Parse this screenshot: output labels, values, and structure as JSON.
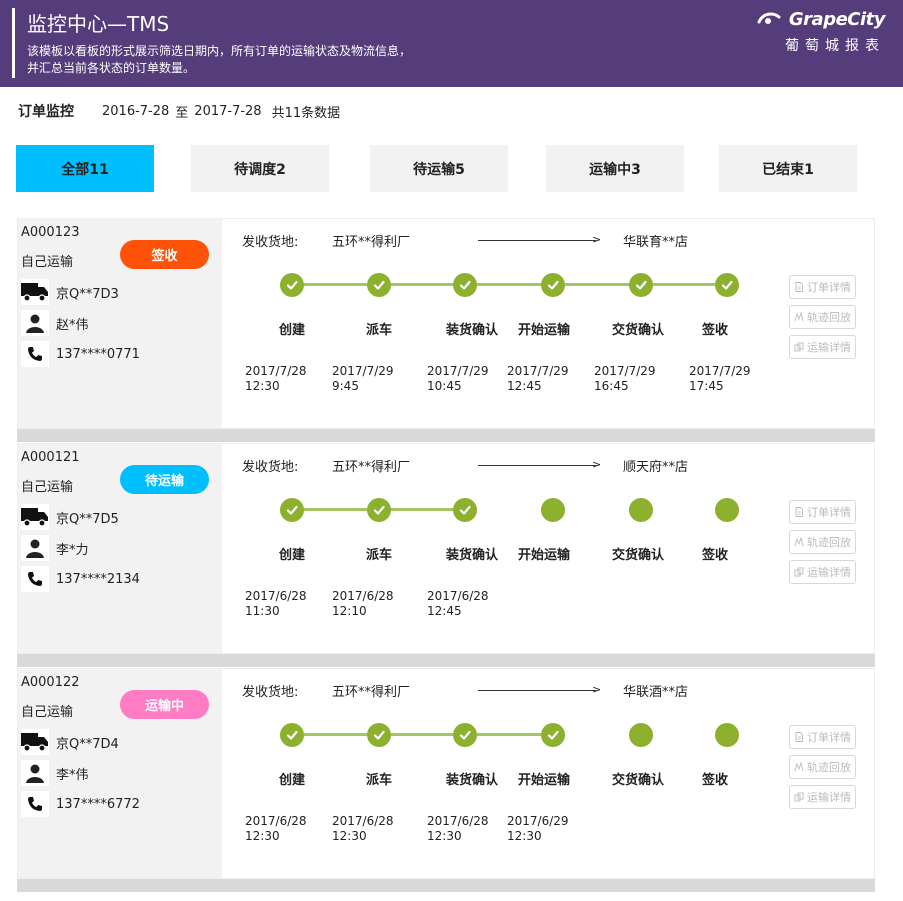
{
  "header": {
    "title": "监控中心—TMS",
    "desc_line1": "该模板以看板的形式展示筛选日期内，所有订单的运输状态及物流信息，",
    "desc_line2": "并汇总当前各状态的订单数量。",
    "brand_word": "GrapeCity",
    "brand_cn": "葡萄城报表"
  },
  "summary": {
    "label": "订单监控",
    "start_date": "2016-7-28",
    "to": "至",
    "end_date": "2017-7-28",
    "count_text": "共11条数据"
  },
  "tabs": [
    {
      "label": "全部11",
      "active": true
    },
    {
      "label": "待调度2",
      "active": false
    },
    {
      "label": "待运输5",
      "active": false
    },
    {
      "label": "运输中3",
      "active": false
    },
    {
      "label": "已结束1",
      "active": false
    }
  ],
  "step_names": [
    "创建",
    "派车",
    "装货确认",
    "开始运输",
    "交货确认",
    "签收"
  ],
  "route_label": "发收货地:",
  "actions": [
    "订单详情",
    "轨迹回放",
    "运输详情"
  ],
  "orders": [
    {
      "id": "A000123",
      "type": "自己运输",
      "status": "签收",
      "status_color": "#ff5209",
      "plate": "京Q**7D3",
      "driver": "赵*伟",
      "phone": "137****0771",
      "from": "五环**得利厂",
      "to": "华联育**店",
      "completed": 6,
      "times": [
        "2017/7/28\n12:30",
        "2017/7/29\n9:45",
        "2017/7/29\n10:45",
        "2017/7/29\n12:45",
        "2017/7/29\n16:45",
        "2017/7/29\n17:45"
      ]
    },
    {
      "id": "A000121",
      "type": "自己运输",
      "status": "待运输",
      "status_color": "#00bfff",
      "plate": "京Q**7D5",
      "driver": "李*力",
      "phone": "137****2134",
      "from": "五环**得利厂",
      "to": "顺天府**店",
      "completed": 3,
      "times": [
        "2017/6/28\n11:30",
        "2017/6/28\n12:10",
        "2017/6/28\n12:45",
        "",
        "",
        ""
      ]
    },
    {
      "id": "A000122",
      "type": "自己运输",
      "status": "运输中",
      "status_color": "#ff7bc4",
      "plate": "京Q**7D4",
      "driver": "李*伟",
      "phone": "137****6772",
      "from": "五环**得利厂",
      "to": "华联酒**店",
      "completed": 4,
      "times": [
        "2017/6/28\n12:30",
        "2017/6/28\n12:30",
        "2017/6/28\n12:30",
        "2017/6/29\n12:30",
        "",
        ""
      ]
    }
  ],
  "colors": {
    "header_bg": "#553c7b",
    "tab_active": "#00bfff",
    "step_done": "#8db02e",
    "step_line": "#a5c564"
  }
}
